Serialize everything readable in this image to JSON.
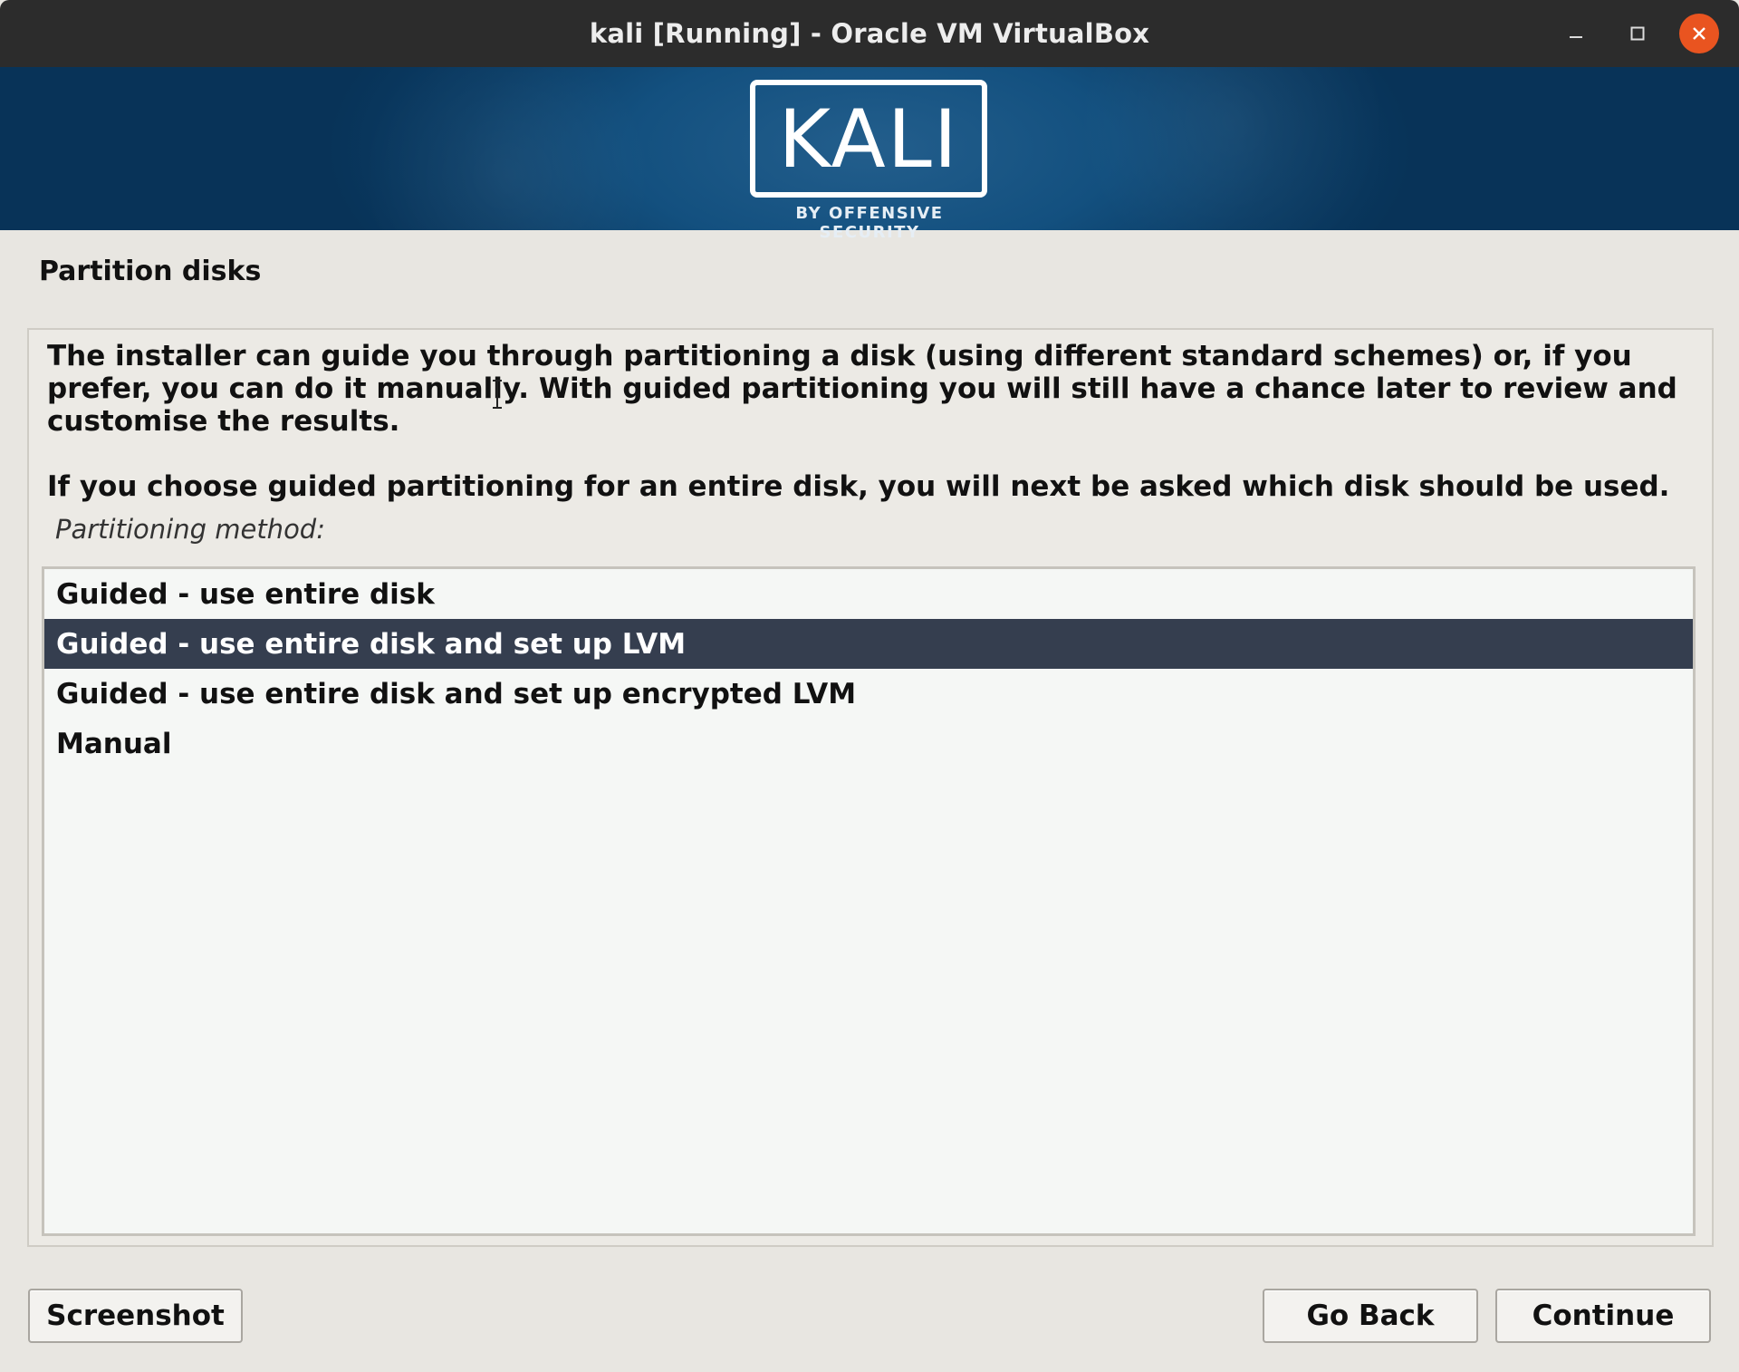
{
  "window": {
    "title": "kali [Running] - Oracle VM VirtualBox",
    "controls": {
      "minimize_icon": "minimize-icon",
      "maximize_icon": "maximize-icon",
      "close_icon": "close-icon",
      "close_color": "#e95420"
    }
  },
  "banner": {
    "logo_text": "KALI",
    "logo_subtext": "BY OFFENSIVE SECURITY",
    "background_color": "#13507f"
  },
  "step": {
    "title": "Partition disks",
    "description": "The installer can guide you through partitioning a disk (using different standard schemes) or, if you prefer, you can do it manually. With guided partitioning you will still have a chance later to review and customise the results.",
    "description2": "If you choose guided partitioning for an entire disk, you will next be asked which disk should be used.",
    "list_label": "Partitioning method:",
    "options": [
      {
        "label": "Guided - use entire disk"
      },
      {
        "label": "Guided - use entire disk and set up LVM"
      },
      {
        "label": "Guided - use entire disk and set up encrypted LVM"
      },
      {
        "label": "Manual"
      }
    ],
    "selected_index": 1,
    "selected_color": "#353e4f"
  },
  "buttons": {
    "screenshot": "Screenshot",
    "go_back": "Go Back",
    "continue": "Continue"
  }
}
